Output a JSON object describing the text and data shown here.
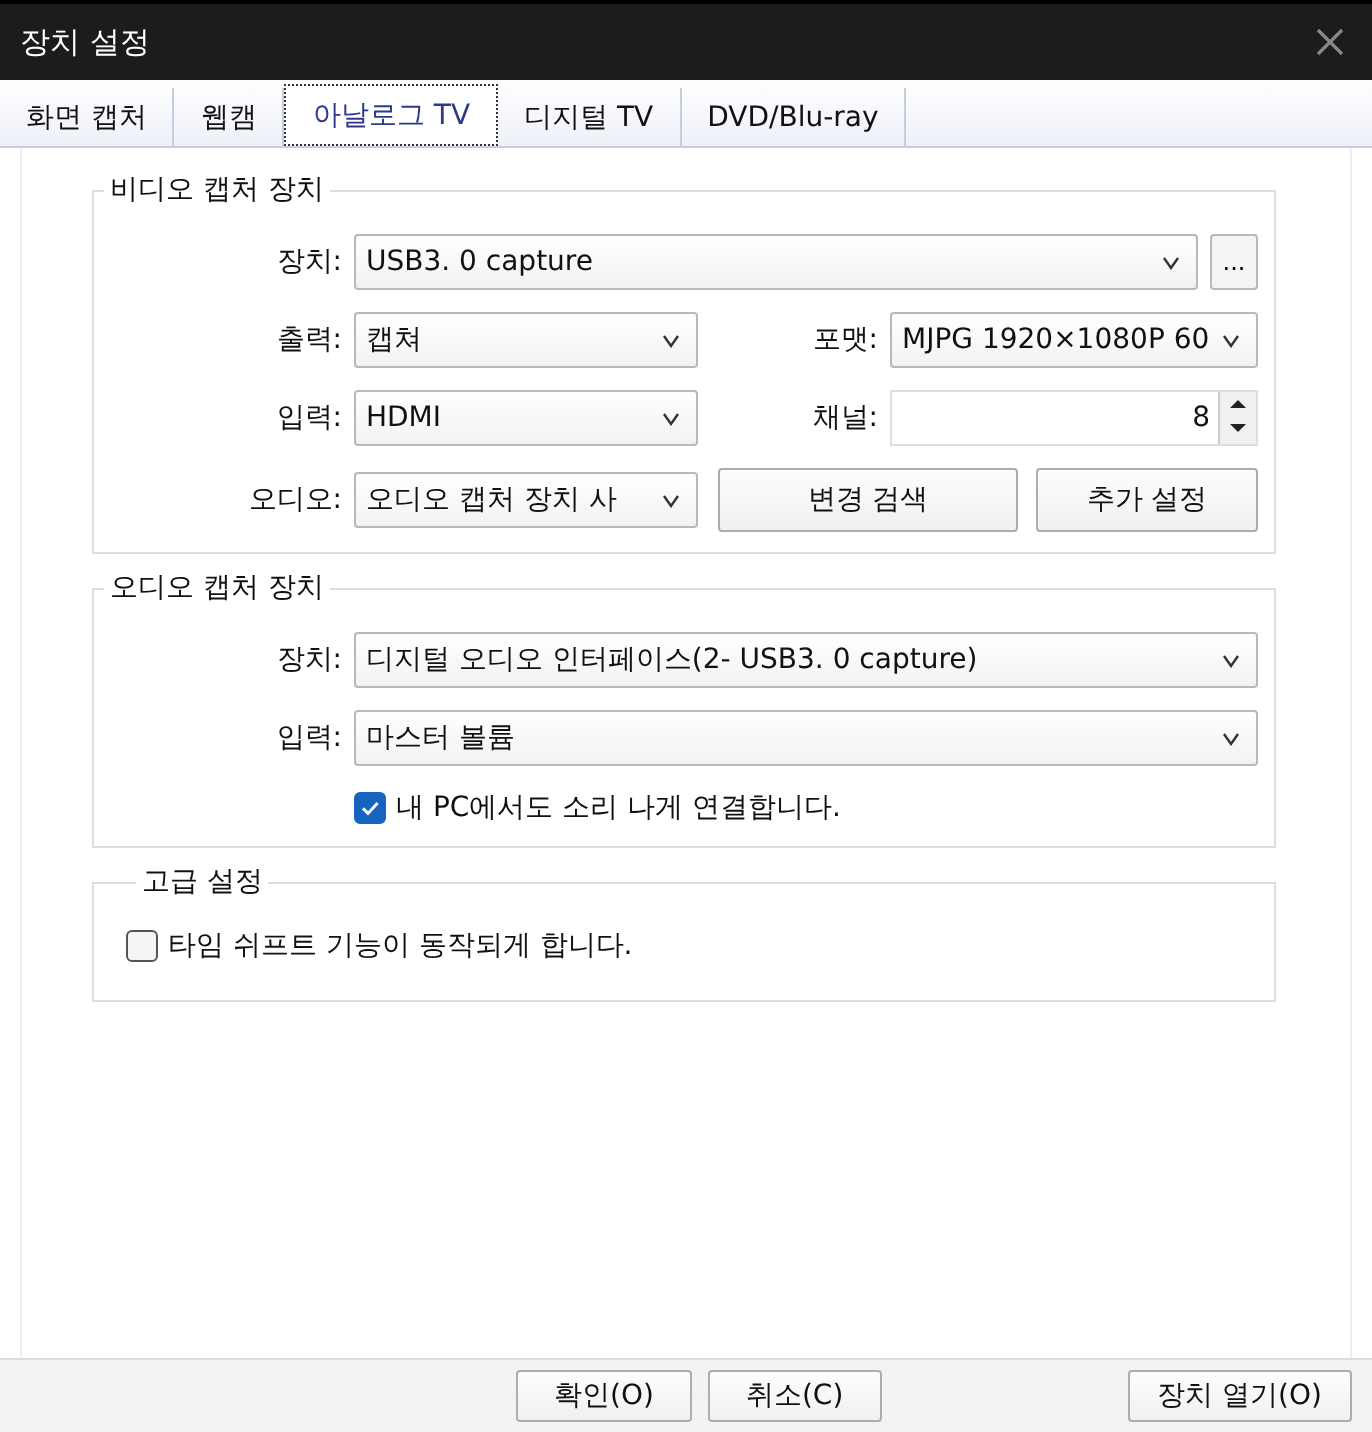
{
  "window": {
    "title": "장치 설정"
  },
  "tabs": [
    {
      "label": "화면 캡처",
      "selected": false
    },
    {
      "label": "웹캠",
      "selected": false
    },
    {
      "label": "아날로그 TV",
      "selected": true
    },
    {
      "label": "디지털 TV",
      "selected": false
    },
    {
      "label": "DVD/Blu-ray",
      "selected": false
    }
  ],
  "video_capture": {
    "title": "비디오 캡처 장치",
    "device": {
      "label": "장치:",
      "value": "USB3. 0 capture"
    },
    "more_button": "...",
    "output": {
      "label": "출력:",
      "value": "캡쳐"
    },
    "format": {
      "label": "포맷:",
      "value": "MJPG 1920×1080P 60"
    },
    "input": {
      "label": "입력:",
      "value": "HDMI"
    },
    "channel": {
      "label": "채널:",
      "value": "8"
    },
    "audio": {
      "label": "오디오:",
      "value": "오디오 캡처 장치 사"
    },
    "buttons": [
      "변경 검색",
      "추가 설정"
    ]
  },
  "audio_capture": {
    "title": "오디오 캡처 장치",
    "device": {
      "label": "장치:",
      "value": "디지털 오디오 인터페이스(2- USB3. 0 capture)"
    },
    "input": {
      "label": "입력:",
      "value": "마스터 볼륨"
    },
    "monitor": {
      "label": "내 PC에서도 소리 나게 연결합니다.",
      "checked": true
    }
  },
  "advanced": {
    "title": "고급 설정",
    "time_shift": {
      "label": "타임 쉬프트 기능이 동작되게 합니다.",
      "checked": false
    }
  },
  "footer": {
    "buttons": [
      "확인(O)",
      "취소(C)"
    ],
    "open_button": "장치 열기(O)"
  }
}
